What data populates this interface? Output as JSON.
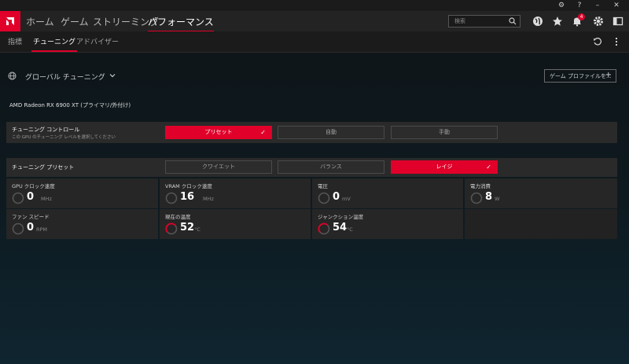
{
  "nav": {
    "items": [
      "ホーム",
      "ゲーム",
      "ストリーミング",
      "パフォーマンス"
    ],
    "search_placeholder": "検索",
    "notification_count": "4"
  },
  "subnav": {
    "items": [
      "指標",
      "チューニング",
      "アドバイザー"
    ]
  },
  "global": {
    "title": "グローバル チューニング",
    "profile_button": "ゲーム プロファイルを..."
  },
  "gpu": {
    "name": "AMD Radeon RX 6900 XT (プライマリ/外付け)"
  },
  "tuning_control": {
    "label": "チューニング コントロール",
    "sublabel": "この GPU のチューニング レベルを選択してください",
    "options": [
      "プリセット",
      "自動",
      "手動"
    ],
    "selected": "プリセット"
  },
  "tuning_preset": {
    "label": "チューニング プリセット",
    "options": [
      "クワイエット",
      "バランス",
      "レイジ"
    ],
    "selected": "レイジ"
  },
  "metrics": [
    {
      "label": "GPU クロック速度",
      "value": "0",
      "unit": "MHz"
    },
    {
      "label": "VRAM クロック速度",
      "value": "16",
      "unit": "MHz"
    },
    {
      "label": "電圧",
      "value": "0",
      "unit": "mV"
    },
    {
      "label": "電力消費",
      "value": "8",
      "unit": "W"
    },
    {
      "label": "ファン スピード",
      "value": "0",
      "unit": "RPM"
    },
    {
      "label": "現在の温度",
      "value": "52",
      "unit": "°C"
    },
    {
      "label": "ジャンクション温度",
      "value": "54",
      "unit": "°C"
    }
  ],
  "colors": {
    "accent": "#e0002a",
    "panel": "#2a2a2a",
    "background": "#0f1a20"
  },
  "icons": [
    "amd-logo",
    "search-icon",
    "globe-icon",
    "star-icon",
    "bell-icon",
    "gear-icon",
    "layout-icon",
    "undo-icon",
    "more-icon",
    "chevron-down-icon",
    "gauge-icon"
  ]
}
